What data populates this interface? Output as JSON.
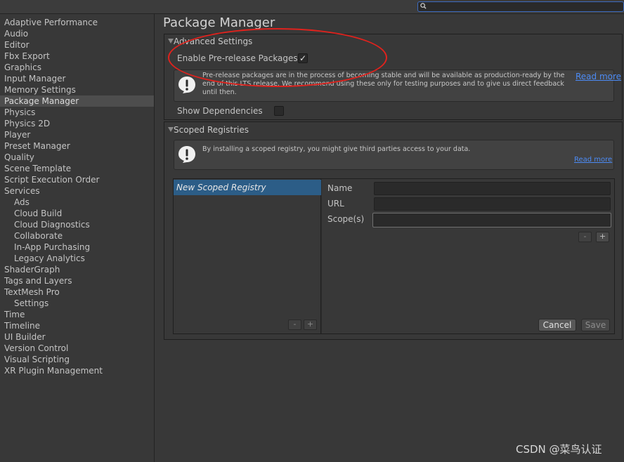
{
  "search": {
    "placeholder": ""
  },
  "sidebar": {
    "items": [
      {
        "label": "Adaptive Performance",
        "level": 0
      },
      {
        "label": "Audio",
        "level": 0
      },
      {
        "label": "Editor",
        "level": 0
      },
      {
        "label": "Fbx Export",
        "level": 0
      },
      {
        "label": "Graphics",
        "level": 0
      },
      {
        "label": "Input Manager",
        "level": 0
      },
      {
        "label": "Memory Settings",
        "level": 0
      },
      {
        "label": "Package Manager",
        "level": 0,
        "selected": true
      },
      {
        "label": "Physics",
        "level": 0
      },
      {
        "label": "Physics 2D",
        "level": 0
      },
      {
        "label": "Player",
        "level": 0
      },
      {
        "label": "Preset Manager",
        "level": 0
      },
      {
        "label": "Quality",
        "level": 0
      },
      {
        "label": "Scene Template",
        "level": 0
      },
      {
        "label": "Script Execution Order",
        "level": 0
      },
      {
        "label": "Services",
        "level": 0
      },
      {
        "label": "Ads",
        "level": 1
      },
      {
        "label": "Cloud Build",
        "level": 1
      },
      {
        "label": "Cloud Diagnostics",
        "level": 1
      },
      {
        "label": "Collaborate",
        "level": 1
      },
      {
        "label": "In-App Purchasing",
        "level": 1
      },
      {
        "label": "Legacy Analytics",
        "level": 1
      },
      {
        "label": "ShaderGraph",
        "level": 0
      },
      {
        "label": "Tags and Layers",
        "level": 0
      },
      {
        "label": "TextMesh Pro",
        "level": 0
      },
      {
        "label": "Settings",
        "level": 1
      },
      {
        "label": "Time",
        "level": 0
      },
      {
        "label": "Timeline",
        "level": 0
      },
      {
        "label": "UI Builder",
        "level": 0
      },
      {
        "label": "Version Control",
        "level": 0
      },
      {
        "label": "Visual Scripting",
        "level": 0
      },
      {
        "label": "XR Plugin Management",
        "level": 0
      }
    ]
  },
  "main": {
    "title": "Package Manager",
    "advanced": {
      "header": "Advanced Settings",
      "enable_prerelease_label": "Enable Pre-release Packages",
      "enable_prerelease_checked": true,
      "check_glyph": "✓",
      "help_text": "Pre-release packages are in the process of becoming stable and will be available as production-ready by the end of this LTS release. We recommend using these only for testing purposes and to give us direct feedback until then.",
      "read_more": "Read more",
      "show_dependencies_label": "Show Dependencies",
      "show_dependencies_checked": false
    },
    "scoped": {
      "header": "Scoped Registries",
      "help_text": "By installing a scoped registry, you might give third parties access to your data.",
      "read_more": "Read more",
      "registries": [
        "New Scoped Registry"
      ],
      "name_label": "Name",
      "url_label": "URL",
      "scopes_label": "Scope(s)",
      "name_value": "",
      "url_value": "",
      "scopes_value": "",
      "minus_label": "-",
      "plus_label": "+",
      "cancel_label": "Cancel",
      "save_label": "Save"
    }
  },
  "watermark": "CSDN @菜鸟认证",
  "colors": {
    "background": "#383838",
    "selected_row": "#4d4d4d",
    "registry_selected": "#2c5d87",
    "link": "#4c8bf5",
    "annotation": "#e0221d"
  }
}
